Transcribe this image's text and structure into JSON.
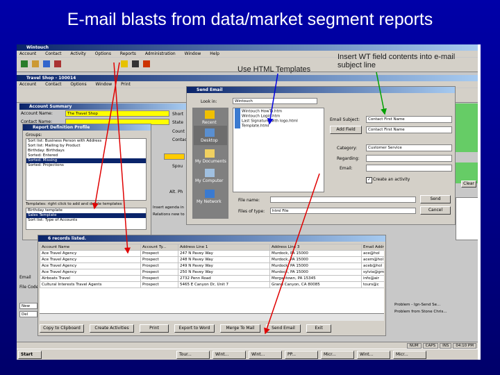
{
  "slide": {
    "title": "E-mail blasts from data/market segment reports"
  },
  "callouts": {
    "templates": "Use HTML Templates",
    "subject": "Insert WT field contents into e-mail subject line"
  },
  "app": {
    "title": "Wintouch",
    "menu": [
      "Account",
      "Contact",
      "Activity",
      "Options",
      "Reports",
      "Administration",
      "Window",
      "Help"
    ],
    "inner_title": "Travel Shop - 100014",
    "inner_menu": [
      "Account",
      "Contact",
      "Options",
      "Window",
      "Print"
    ]
  },
  "account_summary": {
    "title": "Account Summary",
    "name_label": "Account Name:",
    "name_value": "The Travel Shop",
    "contact_label": "Contact Name:",
    "right_labels": [
      "Short",
      "State",
      "Count",
      "Contact",
      "Spou"
    ],
    "side_label_alt": "Alt. Ph"
  },
  "report_def": {
    "title": "Report Definition Profile",
    "groups_label": "Groups:",
    "groups": [
      "Sort list: Business Person with Address",
      "Sort list: Mailing by Product",
      "Birthday: Birthdays",
      "Sorted: Entered",
      "Sorted: Missing",
      "Sorted: Projections"
    ],
    "templates_label": "Templates: right click to add and delete templates",
    "templates": [
      "Birthday template",
      "Sales Template",
      "Sort list: Type of Accounts"
    ],
    "side_notes": [
      "Insert agenda in",
      "Relations new to"
    ]
  },
  "send_email": {
    "title": "Send Email",
    "look_in_label": "Look in:",
    "look_in_value": "Wintouch",
    "places": [
      "Recent",
      "Desktop",
      "My Documents",
      "My Computer",
      "My Network"
    ],
    "files": [
      "Wintouch HowTo.htm",
      "Wintouch Login.htm",
      "Last Signature with logo.html",
      "Template.html"
    ],
    "file_name_label": "File name:",
    "file_type_label": "Files of type:",
    "file_type_value": "html File",
    "open_label": "Send",
    "cancel_label": "Cancel",
    "subject_label": "Email Subject:",
    "subject_value": "Contact First Name",
    "add_field_label": "Add Field",
    "add_field_value": "Contact First Name",
    "category_label": "Category:",
    "category_value": "Customer Service",
    "regarding_label": "Regarding:",
    "email_label": "Email:",
    "checkbox_label": "Create an activity"
  },
  "records": {
    "title": "6 records listed.",
    "columns": [
      "Account Name",
      "Account Ty...",
      "Address Line 1",
      "Address Line 3",
      "Email Addr"
    ],
    "rows": [
      [
        "Ace Travel Agency",
        "Prospect",
        "247 N Pavey Way",
        "Murdock, PA 15000",
        "ace@hol"
      ],
      [
        "Ace Travel Agency",
        "Prospect",
        "248 N Pavey Way",
        "Murdock, PA 15000",
        "acem@hol"
      ],
      [
        "Ace Travel Agency",
        "Prospect",
        "249 N Pavey Way",
        "Murdock, PA 15000",
        "aceb@hol"
      ],
      [
        "Ace Travel Agency",
        "Prospect",
        "250 N Pavey Way",
        "Murdock, PA 15000",
        "sylvia@gm"
      ],
      [
        "Airboats Travel",
        "Prospect",
        "2732 Penn Road",
        "Morgantown, PA 15345",
        "info@air"
      ],
      [
        "Cultural Interests Travel Agents",
        "Prospect",
        "5465 E Canyon Dr, Unit 7",
        "Grand Canyon, CA 80085",
        "tours@c"
      ]
    ],
    "buttons": [
      "Copy to Clipboard",
      "Create Activities",
      "Print",
      "Export to Word",
      "Merge To Mail",
      "Send Email",
      "Exit"
    ]
  },
  "right_panel": {
    "clear_label": "Clear",
    "notes": [
      "Problem - Ign-Send Se...",
      "Problem from Stone Chris..."
    ]
  },
  "left_panel": {
    "labels": [
      "Email",
      "File Code"
    ],
    "items": [
      "New",
      "Del"
    ]
  },
  "status": {
    "items": [
      "NUM",
      "CAPS",
      "INS",
      "04:10 PM"
    ]
  },
  "taskbar": {
    "start": "Start",
    "items": [
      "Tour...",
      "Wint...",
      "Wint...",
      "PP...",
      "Micr...",
      "Wint...",
      "Micr..."
    ]
  }
}
